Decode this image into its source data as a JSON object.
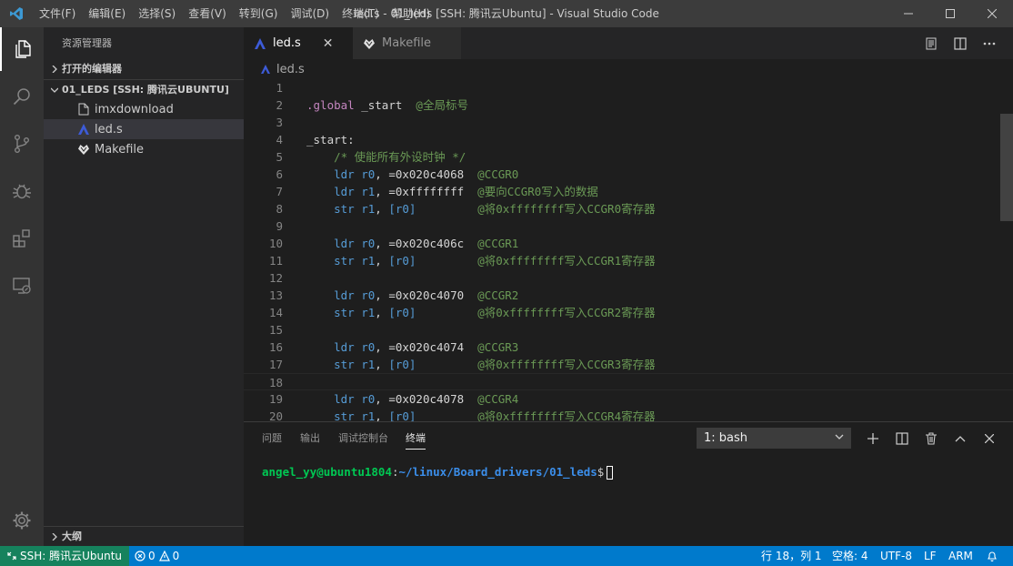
{
  "titlebar": {
    "menus": [
      "文件(F)",
      "编辑(E)",
      "选择(S)",
      "查看(V)",
      "转到(G)",
      "调试(D)",
      "终端(T)",
      "帮助(H)"
    ],
    "window_title": "led.s - 01_leds [SSH: 腾讯云Ubuntu] - Visual Studio Code"
  },
  "activity_bar": {
    "icons": [
      "explorer-icon",
      "search-icon",
      "source-control-icon",
      "debug-icon",
      "extensions-icon",
      "remote-explorer-icon",
      "settings-gear-icon"
    ]
  },
  "sidebar": {
    "title": "资源管理器",
    "open_editors_label": "打开的编辑器",
    "folder_label": "01_LEDS [SSH: 腾讯云UBUNTU]",
    "files": [
      {
        "name": "imxdownload",
        "icon": "file-icon"
      },
      {
        "name": "led.s",
        "icon": "asm-icon"
      },
      {
        "name": "Makefile",
        "icon": "makefile-icon"
      }
    ],
    "outline_label": "大纲"
  },
  "editor": {
    "tabs": [
      {
        "label": "led.s",
        "active": true
      },
      {
        "label": "Makefile",
        "active": false
      }
    ],
    "tab_close_glyph": "✕",
    "breadcrumb": "led.s",
    "current_line": 18,
    "lines": [
      {
        "n": "1",
        "tokens": []
      },
      {
        "n": "2",
        "tokens": [
          {
            "t": ".global",
            "c": "dir"
          },
          {
            "t": " _start  ",
            "c": "label"
          },
          {
            "t": "@全局标号",
            "c": "comment"
          }
        ]
      },
      {
        "n": "3",
        "tokens": []
      },
      {
        "n": "4",
        "tokens": [
          {
            "t": "_start:",
            "c": "label"
          }
        ]
      },
      {
        "n": "5",
        "tokens": [
          {
            "t": "    /* 使能所有外设时钟 */",
            "c": "comment"
          }
        ]
      },
      {
        "n": "6",
        "tokens": [
          {
            "t": "    ldr ",
            "c": "kw"
          },
          {
            "t": "r0",
            "c": "reg"
          },
          {
            "t": ", =0x020c4068  ",
            "c": "num"
          },
          {
            "t": "@CCGR0",
            "c": "comment"
          }
        ]
      },
      {
        "n": "7",
        "tokens": [
          {
            "t": "    ldr ",
            "c": "kw"
          },
          {
            "t": "r1",
            "c": "reg"
          },
          {
            "t": ", =0xffffffff  ",
            "c": "num"
          },
          {
            "t": "@要向CCGR0写入的数据",
            "c": "comment"
          }
        ]
      },
      {
        "n": "8",
        "tokens": [
          {
            "t": "    str ",
            "c": "kw"
          },
          {
            "t": "r1",
            "c": "reg"
          },
          {
            "t": ", ",
            "c": "num"
          },
          {
            "t": "[r0]",
            "c": "reg"
          },
          {
            "t": "         ",
            "c": "num"
          },
          {
            "t": "@将0xffffffff写入CCGR0寄存器",
            "c": "comment"
          }
        ]
      },
      {
        "n": "9",
        "tokens": []
      },
      {
        "n": "10",
        "tokens": [
          {
            "t": "    ldr ",
            "c": "kw"
          },
          {
            "t": "r0",
            "c": "reg"
          },
          {
            "t": ", =0x020c406c  ",
            "c": "num"
          },
          {
            "t": "@CCGR1",
            "c": "comment"
          }
        ]
      },
      {
        "n": "11",
        "tokens": [
          {
            "t": "    str ",
            "c": "kw"
          },
          {
            "t": "r1",
            "c": "reg"
          },
          {
            "t": ", ",
            "c": "num"
          },
          {
            "t": "[r0]",
            "c": "reg"
          },
          {
            "t": "         ",
            "c": "num"
          },
          {
            "t": "@将0xffffffff写入CCGR1寄存器",
            "c": "comment"
          }
        ]
      },
      {
        "n": "12",
        "tokens": []
      },
      {
        "n": "13",
        "tokens": [
          {
            "t": "    ldr ",
            "c": "kw"
          },
          {
            "t": "r0",
            "c": "reg"
          },
          {
            "t": ", =0x020c4070  ",
            "c": "num"
          },
          {
            "t": "@CCGR2",
            "c": "comment"
          }
        ]
      },
      {
        "n": "14",
        "tokens": [
          {
            "t": "    str ",
            "c": "kw"
          },
          {
            "t": "r1",
            "c": "reg"
          },
          {
            "t": ", ",
            "c": "num"
          },
          {
            "t": "[r0]",
            "c": "reg"
          },
          {
            "t": "         ",
            "c": "num"
          },
          {
            "t": "@将0xffffffff写入CCGR2寄存器",
            "c": "comment"
          }
        ]
      },
      {
        "n": "15",
        "tokens": []
      },
      {
        "n": "16",
        "tokens": [
          {
            "t": "    ldr ",
            "c": "kw"
          },
          {
            "t": "r0",
            "c": "reg"
          },
          {
            "t": ", =0x020c4074  ",
            "c": "num"
          },
          {
            "t": "@CCGR3",
            "c": "comment"
          }
        ]
      },
      {
        "n": "17",
        "tokens": [
          {
            "t": "    str ",
            "c": "kw"
          },
          {
            "t": "r1",
            "c": "reg"
          },
          {
            "t": ", ",
            "c": "num"
          },
          {
            "t": "[r0]",
            "c": "reg"
          },
          {
            "t": "         ",
            "c": "num"
          },
          {
            "t": "@将0xffffffff写入CCGR3寄存器",
            "c": "comment"
          }
        ]
      },
      {
        "n": "18",
        "tokens": []
      },
      {
        "n": "19",
        "tokens": [
          {
            "t": "    ldr ",
            "c": "kw"
          },
          {
            "t": "r0",
            "c": "reg"
          },
          {
            "t": ", =0x020c4078  ",
            "c": "num"
          },
          {
            "t": "@CCGR4",
            "c": "comment"
          }
        ]
      },
      {
        "n": "20",
        "tokens": [
          {
            "t": "    str ",
            "c": "kw"
          },
          {
            "t": "r1",
            "c": "reg"
          },
          {
            "t": ", ",
            "c": "num"
          },
          {
            "t": "[r0]",
            "c": "reg"
          },
          {
            "t": "         ",
            "c": "num"
          },
          {
            "t": "@将0xffffffff写入CCGR4寄存器",
            "c": "comment"
          }
        ]
      }
    ]
  },
  "panel": {
    "tabs": [
      "问题",
      "输出",
      "调试控制台",
      "终端"
    ],
    "active_tab": "终端",
    "terminal_selector": "1: bash",
    "prompt_user": "angel_yy@ubuntu1804",
    "prompt_colon": ":",
    "prompt_path": "~/linux/Board_drivers/01_leds",
    "prompt_symbol": "$"
  },
  "statusbar": {
    "remote": "SSH: 腾讯云Ubuntu",
    "errors": "0",
    "warnings": "0",
    "cursor_position": "行 18，列 1",
    "indent": "空格: 4",
    "encoding": "UTF-8",
    "eol": "LF",
    "language": "ARM"
  },
  "colors": {
    "accent": "#007acc",
    "remote": "#16825d",
    "activity_bar": "#333333",
    "sidebar": "#252526",
    "editor": "#1e1e1e"
  }
}
